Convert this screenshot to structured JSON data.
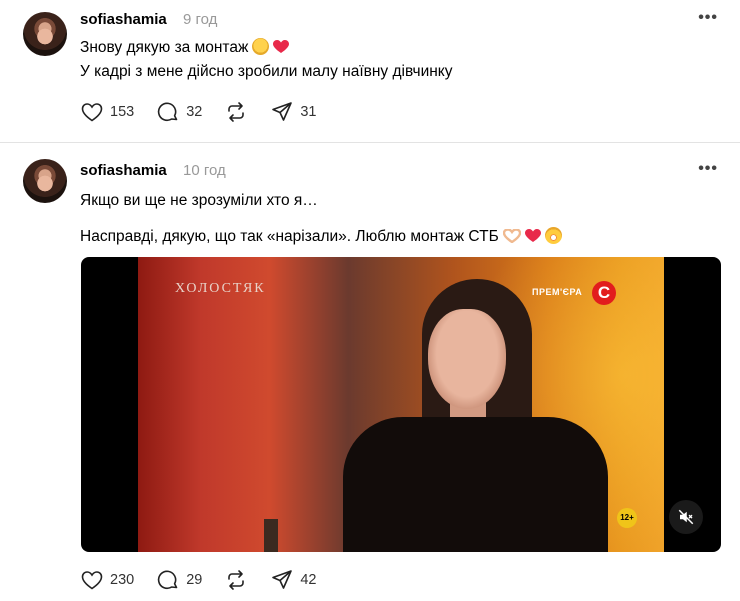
{
  "posts": [
    {
      "username": "sofiashamia",
      "time": "9 год",
      "lines": [
        "Знову дякую за монтаж",
        "У кадрі з мене дійсно зробили малу наївну дівчинку"
      ],
      "actions": {
        "likes": "153",
        "comments": "32",
        "reposts": "",
        "shares": "31"
      }
    },
    {
      "username": "sofiashamia",
      "time": "10 год",
      "lines": [
        "Якщо ви ще не зрозуміли хто я…",
        "Насправді, дякую, що так «нарізали». Люблю монтаж СТБ"
      ],
      "actions": {
        "likes": "230",
        "comments": "29",
        "reposts": "",
        "shares": "42"
      }
    }
  ],
  "video": {
    "show_logo": "ХОЛОСТЯК",
    "premiere_label": "ПРЕМ'ЄРА",
    "channel_logo": "С",
    "age_rating": "12+"
  },
  "icons": {
    "more": "more-horizontal-icon",
    "like": "heart-outline-icon",
    "comment": "comment-bubble-icon",
    "repost": "repost-arrows-icon",
    "share": "send-paper-plane-icon",
    "mute": "speaker-muted-icon"
  },
  "colors": {
    "heart_emoji": "#e8294a",
    "muted_text": "#999999"
  }
}
